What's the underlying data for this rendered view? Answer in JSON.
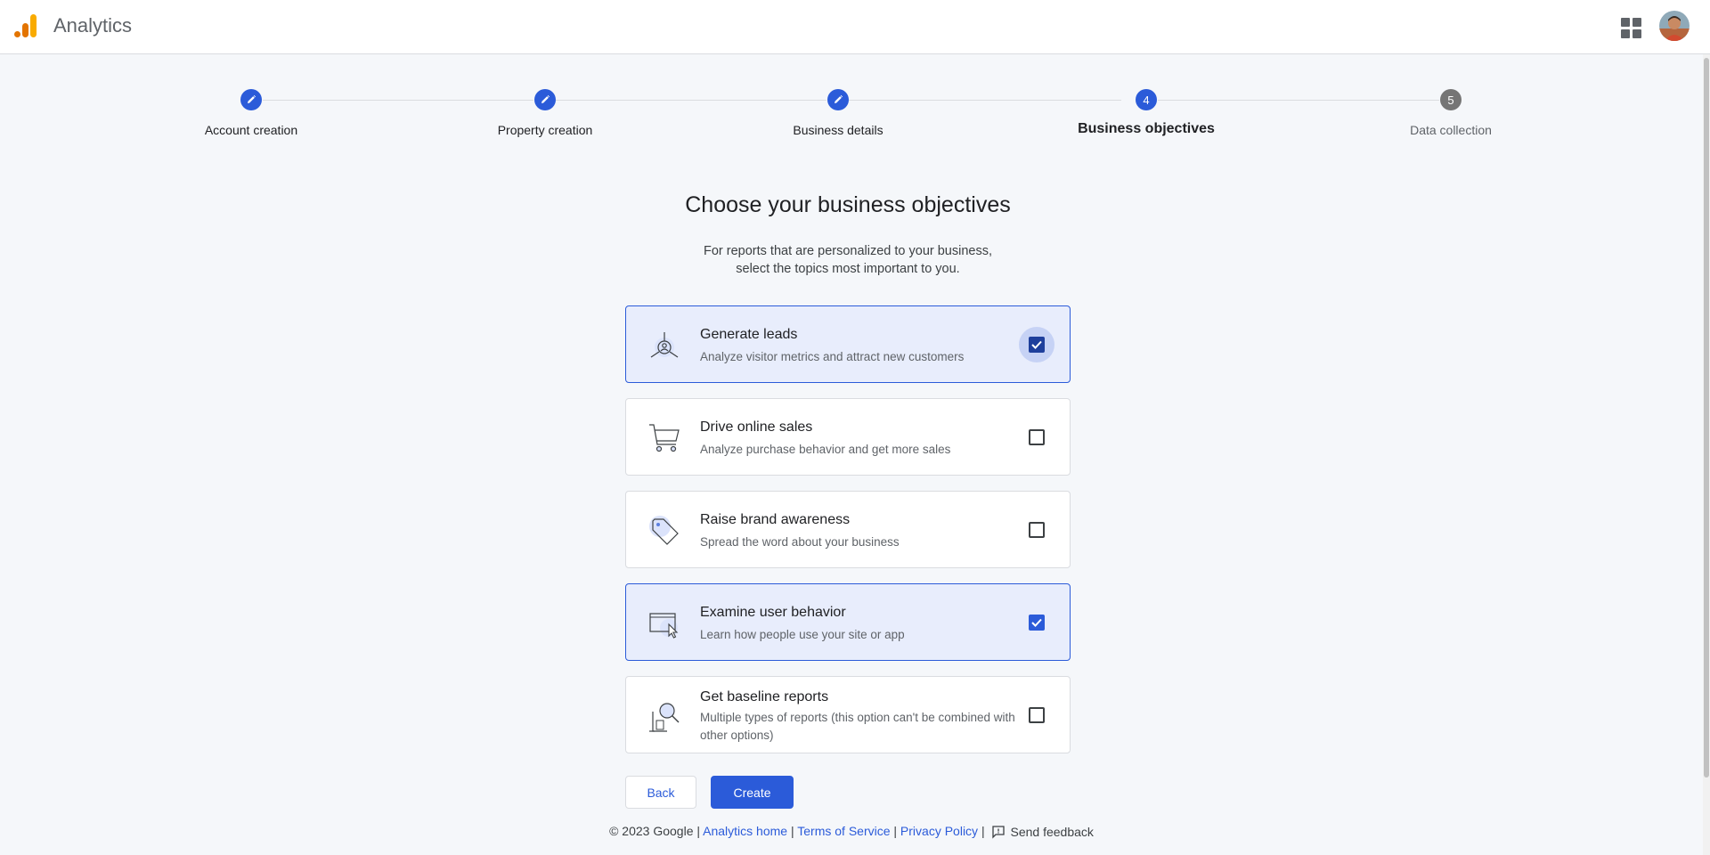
{
  "header": {
    "app_title": "Analytics",
    "logo_icon": "analytics-logo",
    "apps_icon": "apps-grid-icon",
    "avatar": "user-avatar"
  },
  "stepper": {
    "steps": [
      {
        "label": "Account creation",
        "state": "done",
        "icon": "pencil-icon"
      },
      {
        "label": "Property creation",
        "state": "done",
        "icon": "pencil-icon"
      },
      {
        "label": "Business details",
        "state": "done",
        "icon": "pencil-icon"
      },
      {
        "label": "Business objectives",
        "state": "active",
        "number": "4"
      },
      {
        "label": "Data collection",
        "state": "pending",
        "number": "5"
      }
    ]
  },
  "main": {
    "heading": "Choose your business objectives",
    "subtext_line1": "For reports that are personalized to your business,",
    "subtext_line2": "select the topics most important to you.",
    "objectives": [
      {
        "title": "Generate leads",
        "desc": "Analyze visitor metrics and attract new customers",
        "checked": true,
        "icon": "leads-target-icon"
      },
      {
        "title": "Drive online sales",
        "desc": "Analyze purchase behavior and get more sales",
        "checked": false,
        "icon": "shopping-cart-icon"
      },
      {
        "title": "Raise brand awareness",
        "desc": "Spread the word about your business",
        "checked": false,
        "icon": "price-tag-icon"
      },
      {
        "title": "Examine user behavior",
        "desc": "Learn how people use your site or app",
        "checked": true,
        "icon": "browser-cursor-icon"
      },
      {
        "title": "Get baseline reports",
        "desc": "Multiple types of reports (this option can't be combined with other options)",
        "checked": false,
        "icon": "document-search-icon"
      }
    ]
  },
  "actions": {
    "back_label": "Back",
    "create_label": "Create"
  },
  "footer": {
    "copyright": "© 2023 Google |",
    "analytics_home": "Analytics home",
    "sep": "|",
    "terms": "Terms of Service",
    "privacy": "Privacy Policy",
    "send_feedback": "Send feedback"
  },
  "colors": {
    "accent": "#2b5bd9",
    "selected_card_bg": "#e8edfc",
    "pending_step": "#757575"
  }
}
